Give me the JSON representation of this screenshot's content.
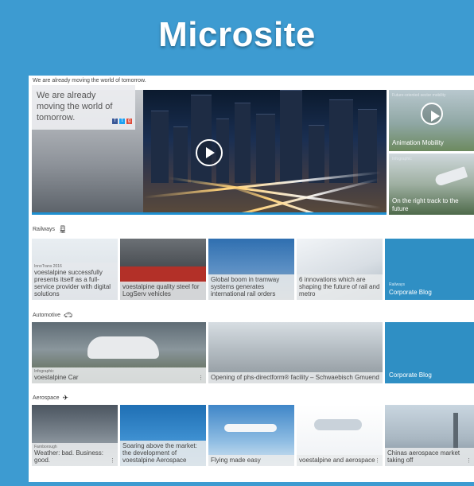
{
  "banner": {
    "title": "Microsite"
  },
  "site": {
    "tagline": "We are already moving the world of tomorrow.",
    "hero": {
      "headline": "We are already moving the world of tomorrow.",
      "social": [
        "f",
        "t",
        "g"
      ],
      "side": [
        {
          "kicker": "Future-oriented sector mobility",
          "label": "Animation Mobility"
        },
        {
          "kicker": "Infographic",
          "label": "On the right track to the future"
        }
      ]
    },
    "sections": {
      "railways": {
        "title": "Railways",
        "icon": "train-icon",
        "tiles": [
          {
            "kicker": "InnoTrans 2016",
            "title": "voestalpine successfully presents itself as a full-service provider with digital solutions"
          },
          {
            "kicker": "",
            "title": "voestalpine quality steel for LogServ vehicles"
          },
          {
            "kicker": "",
            "title": "Global boom in tramway systems generates international rail orders"
          },
          {
            "kicker": "",
            "title": "6 innovations which are shaping the future of rail and metro"
          }
        ],
        "blog": {
          "kicker": "Railways",
          "title": "Corporate Blog"
        }
      },
      "automotive": {
        "title": "Automotive",
        "icon": "car-icon",
        "tiles": [
          {
            "kicker": "Infographic",
            "title": "voestalpine Car"
          },
          {
            "kicker": "",
            "title": "Opening of phs-directform® facility – Schwaebisch Gmuend"
          }
        ],
        "blog": {
          "kicker": "",
          "title": "Corporate Blog"
        }
      },
      "aerospace": {
        "title": "Aerospace",
        "icon": "airplane-icon",
        "tiles": [
          {
            "kicker": "Farnborough",
            "title": "Weather: bad. Business: good."
          },
          {
            "kicker": "",
            "title": "Soaring above the market: the development of voestalpine Aerospace"
          },
          {
            "kicker": "",
            "title": "Flying made easy"
          },
          {
            "kicker": "",
            "title": "voestalpine and aerospace"
          },
          {
            "kicker": "",
            "title": "Chinas aerospace market taking off"
          }
        ]
      }
    }
  },
  "colors": {
    "background": "#3d9bd1",
    "blog": "#2f8fc4",
    "accent": "#1e8fd0"
  }
}
